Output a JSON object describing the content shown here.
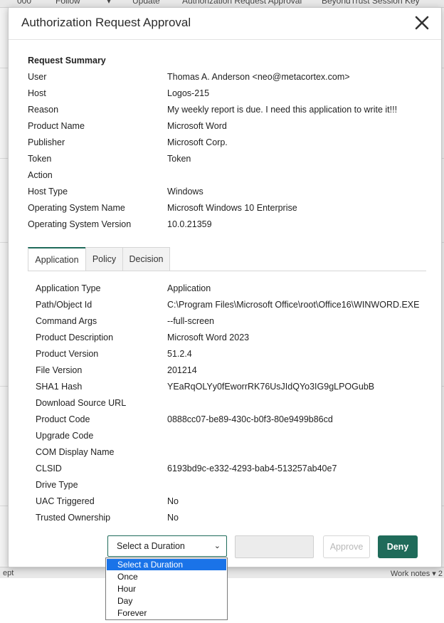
{
  "background": {
    "header_items": [
      "000",
      "Follow",
      "▾",
      "Update",
      "Authorization Request Approval",
      "BeyondTrust Session Key"
    ],
    "footer_left": "ept",
    "footer_right": "Work notes ▾ 2"
  },
  "modal": {
    "title": "Authorization Request Approval",
    "close_icon": "close-icon"
  },
  "summary": {
    "title": "Request Summary",
    "rows": [
      {
        "label": "User",
        "value": "Thomas A. Anderson <neo@metacortex.com>"
      },
      {
        "label": "Host",
        "value": "Logos-215"
      },
      {
        "label": "Reason",
        "value": "My weekly report is due. I need this application to write it!!!"
      },
      {
        "label": "Product Name",
        "value": "Microsoft Word"
      },
      {
        "label": "Publisher",
        "value": "Microsoft Corp."
      },
      {
        "label": "Token",
        "value": "Token"
      },
      {
        "label": "Action",
        "value": ""
      },
      {
        "label": "Host Type",
        "value": "Windows"
      },
      {
        "label": "Operating System Name",
        "value": "Microsoft Windows 10 Enterprise"
      },
      {
        "label": "Operating System Version",
        "value": "10.0.21359"
      }
    ]
  },
  "tabs": [
    {
      "label": "Application",
      "active": true
    },
    {
      "label": "Policy",
      "active": false
    },
    {
      "label": "Decision",
      "active": false
    }
  ],
  "application": {
    "rows": [
      {
        "label": "Application Type",
        "value": "Application"
      },
      {
        "label": "Path/Object Id",
        "value": "C:\\Program Files\\Microsoft Office\\root\\Office16\\WINWORD.EXE"
      },
      {
        "label": "Command Args",
        "value": "--full-screen"
      },
      {
        "label": "Product Description",
        "value": "Microsoft Word 2023"
      },
      {
        "label": "Product Version",
        "value": "51.2.4"
      },
      {
        "label": "File Version",
        "value": "201214"
      },
      {
        "label": "SHA1 Hash",
        "value": "YEaRqOLYy0fEworrRK76UsJIdQYo3IG9gLPOGubB"
      },
      {
        "label": "Download Source URL",
        "value": ""
      },
      {
        "label": "Product Code",
        "value": "0888cc07-be89-430c-b0f3-80e9499b86cd"
      },
      {
        "label": "Upgrade Code",
        "value": ""
      },
      {
        "label": "COM Display Name",
        "value": ""
      },
      {
        "label": "CLSID",
        "value": "6193bd9c-e332-4293-bab4-513257ab40e7"
      },
      {
        "label": "Drive Type",
        "value": ""
      },
      {
        "label": "UAC Triggered",
        "value": "No"
      },
      {
        "label": "Trusted Ownership",
        "value": "No"
      }
    ]
  },
  "footer": {
    "duration_selected": "Select a Duration",
    "duration_options": [
      "Select a Duration",
      "Once",
      "Hour",
      "Day",
      "Forever"
    ],
    "approve_label": "Approve",
    "deny_label": "Deny"
  },
  "colors": {
    "accent": "#1f6b5a",
    "selected_option": "#1a73e8"
  }
}
